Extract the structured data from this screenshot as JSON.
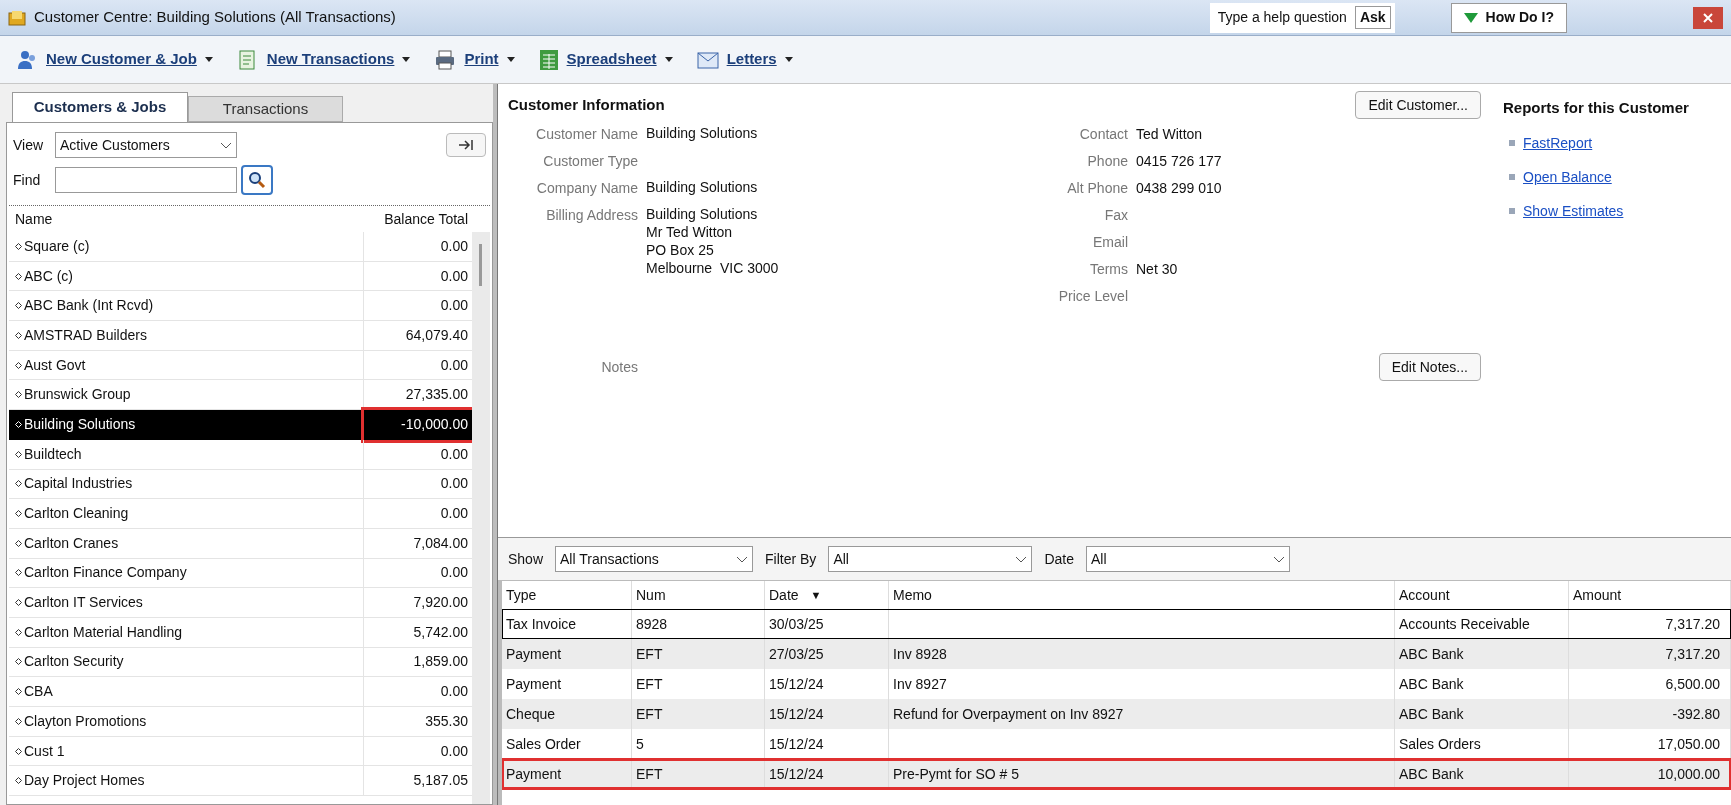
{
  "window": {
    "title": "Customer Centre: Building Solutions (All Transactions)",
    "help_placeholder": "Type a help question",
    "ask": "Ask",
    "how_do_i": "How Do I?"
  },
  "toolbar": [
    {
      "label": "New Customer & Job",
      "kind": "person"
    },
    {
      "label": "New Transactions",
      "kind": "doc"
    },
    {
      "label": "Print",
      "kind": "printer"
    },
    {
      "label": "Spreadsheet",
      "kind": "sheet"
    },
    {
      "label": "Letters",
      "kind": "letter"
    }
  ],
  "tabs": [
    {
      "label": "Customers & Jobs",
      "selected": true
    },
    {
      "label": "Transactions",
      "selected": false
    }
  ],
  "view": {
    "label": "View",
    "value": "Active Customers"
  },
  "find": {
    "label": "Find"
  },
  "customers": {
    "columns": [
      "Name",
      "Balance Total"
    ],
    "rows": [
      {
        "name": "Square (c)",
        "balance": "0.00",
        "selected": false,
        "highlighted": false
      },
      {
        "name": "ABC (c)",
        "balance": "0.00",
        "selected": false,
        "highlighted": false
      },
      {
        "name": "ABC Bank (Int Rcvd)",
        "balance": "0.00",
        "selected": false,
        "highlighted": false
      },
      {
        "name": "AMSTRAD Builders",
        "balance": "64,079.40",
        "selected": false,
        "highlighted": false
      },
      {
        "name": "Aust Govt",
        "balance": "0.00",
        "selected": false,
        "highlighted": false
      },
      {
        "name": "Brunswick Group",
        "balance": "27,335.00",
        "selected": false,
        "highlighted": false
      },
      {
        "name": "Building Solutions",
        "balance": "-10,000.00",
        "selected": true,
        "highlighted": true
      },
      {
        "name": "Buildtech",
        "balance": "0.00",
        "selected": false,
        "highlighted": false
      },
      {
        "name": "Capital Industries",
        "balance": "0.00",
        "selected": false,
        "highlighted": false
      },
      {
        "name": "Carlton Cleaning",
        "balance": "0.00",
        "selected": false,
        "highlighted": false
      },
      {
        "name": "Carlton Cranes",
        "balance": "7,084.00",
        "selected": false,
        "highlighted": false
      },
      {
        "name": "Carlton Finance Company",
        "balance": "0.00",
        "selected": false,
        "highlighted": false
      },
      {
        "name": "Carlton IT Services",
        "balance": "7,920.00",
        "selected": false,
        "highlighted": false
      },
      {
        "name": "Carlton Material Handling",
        "balance": "5,742.00",
        "selected": false,
        "highlighted": false
      },
      {
        "name": "Carlton Security",
        "balance": "1,859.00",
        "selected": false,
        "highlighted": false
      },
      {
        "name": "CBA",
        "balance": "0.00",
        "selected": false,
        "highlighted": false
      },
      {
        "name": "Clayton Promotions",
        "balance": "355.30",
        "selected": false,
        "highlighted": false
      },
      {
        "name": "Cust 1",
        "balance": "0.00",
        "selected": false,
        "highlighted": false
      },
      {
        "name": "Day Project Homes",
        "balance": "5,187.05",
        "selected": false,
        "highlighted": false
      }
    ]
  },
  "customer_info": {
    "title": "Customer Information",
    "edit_button": "Edit Customer...",
    "left_fields": [
      {
        "label": "Customer Name",
        "lines": [
          "Building Solutions"
        ]
      },
      {
        "label": "Customer Type"
      },
      {
        "label": "Company Name",
        "lines": [
          "Building Solutions"
        ]
      },
      {
        "label": "Billing Address",
        "lines": [
          "Building Solutions",
          "Mr Ted Witton",
          "PO Box 25",
          "Melbourne  VIC 3000"
        ]
      }
    ],
    "right_fields": [
      {
        "label": "Contact",
        "value": "Ted Witton"
      },
      {
        "label": "Phone",
        "value": "0415 726 177"
      },
      {
        "label": "Alt Phone",
        "value": "0438 299 010"
      },
      {
        "label": "Fax"
      },
      {
        "label": "Email"
      },
      {
        "label": "Terms",
        "value": "Net 30"
      },
      {
        "label": "Price Level"
      }
    ],
    "notes_label": "Notes",
    "notes_button": "Edit Notes..."
  },
  "reports": {
    "title": "Reports for this Customer",
    "links": [
      "FastReport",
      "Open Balance",
      "Show Estimates"
    ]
  },
  "filters": [
    {
      "label": "Show",
      "value": "All Transactions"
    },
    {
      "label": "Filter By",
      "value": "All"
    },
    {
      "label": "Date",
      "value": "All"
    }
  ],
  "transactions": {
    "columns": [
      "Type",
      "Num",
      "Date",
      "Memo",
      "Account",
      "Amount"
    ],
    "sort_indicator": "▼",
    "rows": [
      {
        "cells": [
          "Tax Invoice",
          "8928",
          "30/03/25",
          "",
          "Accounts Receivable",
          "7,317.20"
        ],
        "focused": true,
        "highlighted": false
      },
      {
        "cells": [
          "Payment",
          "EFT",
          "27/03/25",
          "Inv 8928",
          "ABC Bank",
          "7,317.20"
        ],
        "focused": false,
        "highlighted": false
      },
      {
        "cells": [
          "Payment",
          "EFT",
          "15/12/24",
          "Inv 8927",
          "ABC Bank",
          "6,500.00"
        ],
        "focused": false,
        "highlighted": false
      },
      {
        "cells": [
          "Cheque",
          "EFT",
          "15/12/24",
          "Refund for Overpayment on Inv 8927",
          "ABC Bank",
          "-392.80"
        ],
        "focused": false,
        "highlighted": false
      },
      {
        "cells": [
          "Sales Order",
          "5",
          "15/12/24",
          "",
          "Sales Orders",
          "17,050.00"
        ],
        "focused": false,
        "highlighted": false
      },
      {
        "cells": [
          "Payment",
          "EFT",
          "15/12/24",
          "Pre-Pymt for SO # 5",
          "ABC Bank",
          "10,000.00"
        ],
        "focused": false,
        "highlighted": true
      }
    ]
  }
}
